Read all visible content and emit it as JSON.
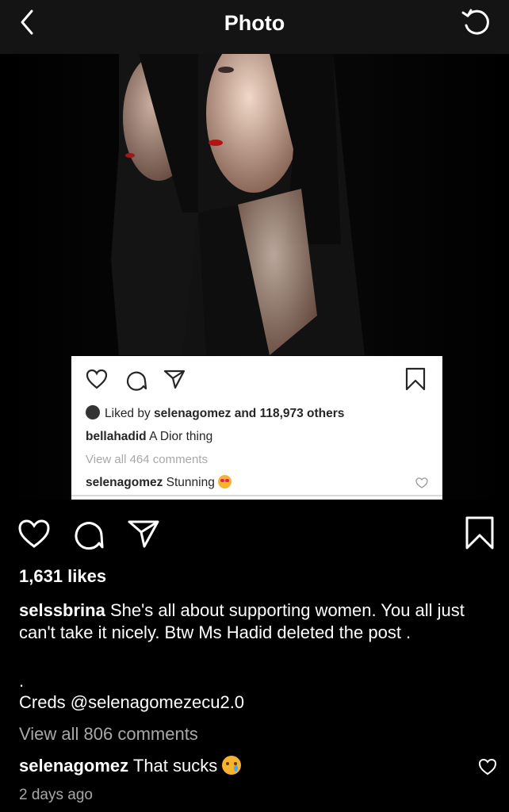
{
  "nav": {
    "title": "Photo",
    "back_icon": "chevron-left-icon",
    "refresh_icon": "refresh-icon"
  },
  "embedded_card": {
    "liked_prefix": "Liked by ",
    "liked_user": "selenagomez",
    "liked_suffix": " and 118,973 others",
    "caption_user": "bellahadid",
    "caption_text": " A Dior thing",
    "view_all": "View all 464 comments",
    "comment_user": "selenagomez",
    "comment_text": " Stunning",
    "comment_emoji": "heart-eyes-emoji"
  },
  "post": {
    "likes": "1,631 likes",
    "caption_user": "selssbrina",
    "caption_text": " She's all about supporting women. You all just can't take it nicely. Btw Ms Hadid deleted the post .",
    "dot": ".",
    "creds": "Creds @selenagomezecu2.0",
    "view_all": "View all 806 comments",
    "comment_user": "selenagomez",
    "comment_text": " That sucks",
    "comment_emoji": "crying-face-emoji",
    "time": "2 days ago"
  },
  "colors": {
    "background": "#000000",
    "navbar": "#141414",
    "muted_text": "#a8a8a8",
    "card_bg": "#ffffff"
  }
}
